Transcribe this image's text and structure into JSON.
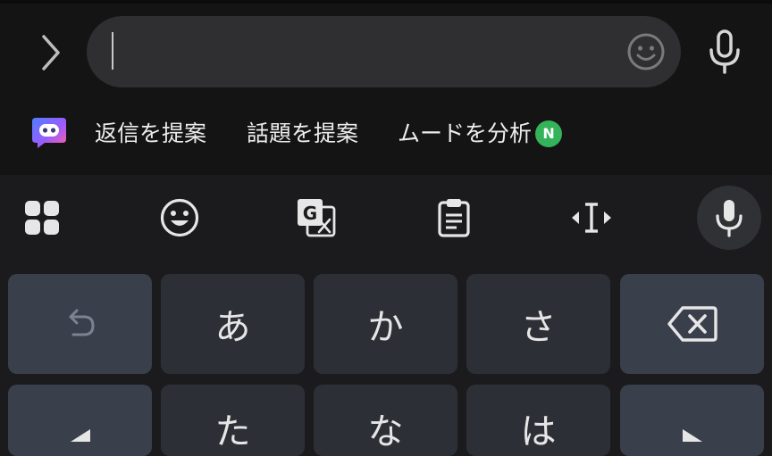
{
  "colors": {
    "top_background": "#141414",
    "keyboard_background": "#1b1b1d",
    "input_pill": "#2f2f31",
    "char_key": "#2c2f36",
    "func_key": "#3a3f4c",
    "new_badge": "#35b35a"
  },
  "input": {
    "value": "",
    "emoji_icon": "smiley-icon"
  },
  "suggestions": {
    "logo_icon": "ai-assistant-icon",
    "chips": [
      {
        "label": "返信を提案"
      },
      {
        "label": "話題を提案"
      },
      {
        "label": "ムードを分析",
        "badge": "N"
      }
    ]
  },
  "toolbar": {
    "items": [
      "apps-grid-icon",
      "emoji-icon",
      "translate-icon",
      "clipboard-icon",
      "text-cursor-icon",
      "mic-icon"
    ]
  },
  "keys": {
    "row1": [
      "",
      "あ",
      "か",
      "さ",
      ""
    ],
    "row2": [
      "",
      "た",
      "な",
      "は",
      ""
    ]
  }
}
